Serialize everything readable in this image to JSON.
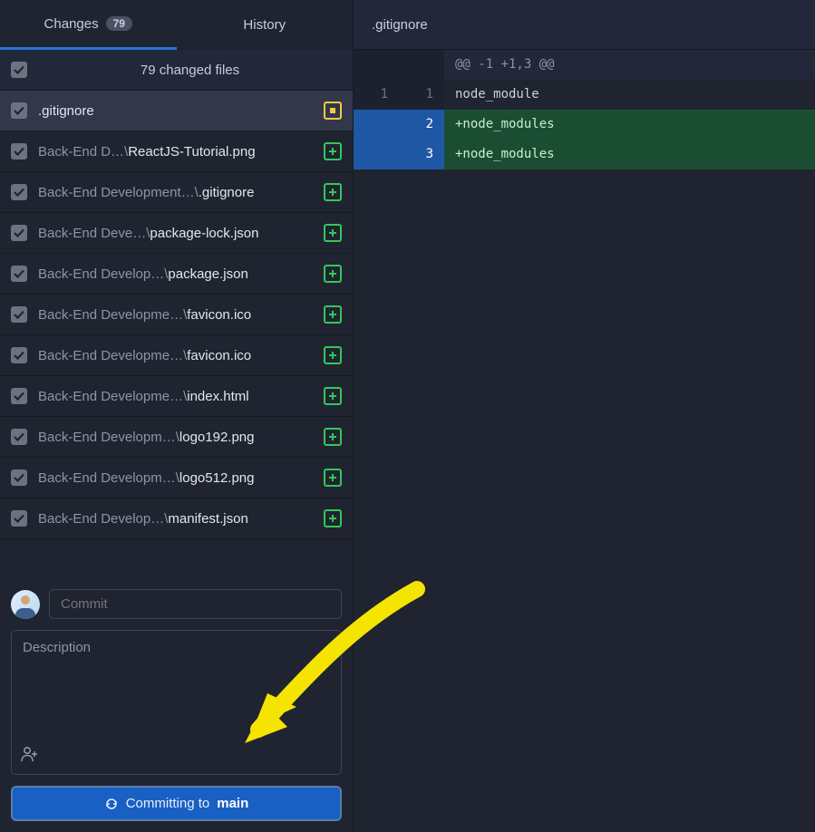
{
  "tabs": {
    "changes": "Changes",
    "changes_count": "79",
    "history": "History"
  },
  "header": {
    "changed_files": "79 changed files"
  },
  "files": [
    {
      "prefix": "",
      "name": ".gitignore",
      "status": "modified",
      "selected": true
    },
    {
      "prefix": "Back-End D…\\",
      "name": "ReactJS-Tutorial.png",
      "status": "added",
      "selected": false
    },
    {
      "prefix": "Back-End Development…\\",
      "name": ".gitignore",
      "status": "added",
      "selected": false
    },
    {
      "prefix": "Back-End Deve…\\",
      "name": "package-lock.json",
      "status": "added",
      "selected": false
    },
    {
      "prefix": "Back-End Develop…\\",
      "name": "package.json",
      "status": "added",
      "selected": false
    },
    {
      "prefix": "Back-End Developme…\\",
      "name": "favicon.ico",
      "status": "added",
      "selected": false
    },
    {
      "prefix": "Back-End Developme…\\",
      "name": "favicon.ico",
      "status": "added",
      "selected": false
    },
    {
      "prefix": "Back-End Developme…\\",
      "name": "index.html",
      "status": "added",
      "selected": false
    },
    {
      "prefix": "Back-End Developm…\\",
      "name": "logo192.png",
      "status": "added",
      "selected": false
    },
    {
      "prefix": "Back-End Developm…\\",
      "name": "logo512.png",
      "status": "added",
      "selected": false
    },
    {
      "prefix": "Back-End Develop…\\",
      "name": "manifest.json",
      "status": "added",
      "selected": false
    }
  ],
  "commit": {
    "summary_placeholder": "Commit",
    "description_placeholder": "Description",
    "button_prefix": "Committing to ",
    "branch": "main"
  },
  "editor": {
    "filename": ".gitignore",
    "diff": {
      "hunk": "@@ -1 +1,3 @@",
      "lines": [
        {
          "old": "1",
          "new": "1",
          "type": "ctx",
          "text": " node_module"
        },
        {
          "old": "",
          "new": "2",
          "type": "add",
          "text": "+node_modules"
        },
        {
          "old": "",
          "new": "3",
          "type": "add",
          "text": "+node_modules"
        }
      ]
    }
  }
}
